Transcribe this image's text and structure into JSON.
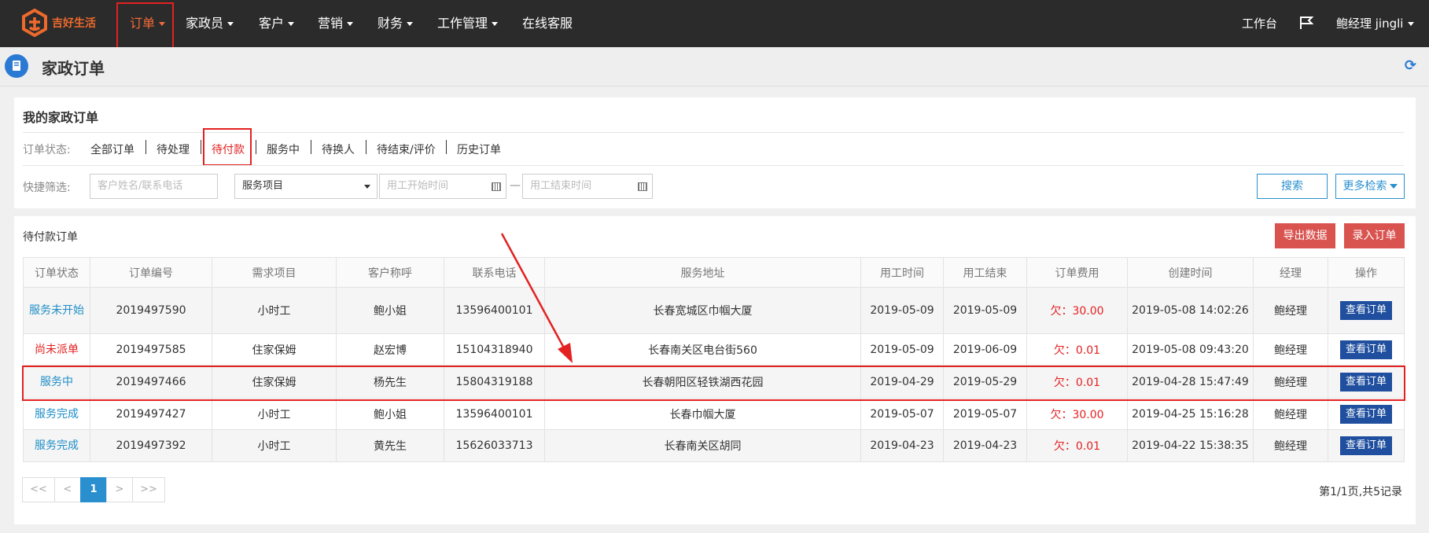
{
  "brand": {
    "name": "吉好生活",
    "color": "#ee6a2c"
  },
  "nav": {
    "items": [
      {
        "label": "订单",
        "dropdown": true,
        "active": true
      },
      {
        "label": "家政员",
        "dropdown": true
      },
      {
        "label": "客户",
        "dropdown": true
      },
      {
        "label": "营销",
        "dropdown": true
      },
      {
        "label": "财务",
        "dropdown": true
      },
      {
        "label": "工作管理",
        "dropdown": true
      },
      {
        "label": "在线客服",
        "dropdown": false
      }
    ],
    "workbench": "工作台",
    "flag_icon": "flag-icon",
    "user": "鲍经理 jingli"
  },
  "page": {
    "title": "家政订单",
    "icon": "book-icon",
    "refresh_icon": "refresh-icon"
  },
  "filters": {
    "title": "我的家政订单",
    "status_label": "订单状态:",
    "statuses": [
      "全部订单",
      "待处理",
      "待付款",
      "服务中",
      "待换人",
      "待结束/评价",
      "历史订单"
    ],
    "active_status": "待付款",
    "quick_label": "快捷筛选:",
    "customer_placeholder": "客户姓名/联系电话",
    "service_select": "服务项目",
    "start_placeholder": "用工开始时间",
    "range_sep": "—",
    "end_placeholder": "用工结束时间",
    "search_button": "搜索",
    "more_button": "更多检索"
  },
  "table_panel": {
    "title": "待付款订单",
    "export_button": "导出数据",
    "add_button": "录入订单",
    "columns": [
      "订单状态",
      "订单编号",
      "需求项目",
      "客户称呼",
      "联系电话",
      "服务地址",
      "用工时间",
      "用工结束",
      "订单费用",
      "创建时间",
      "经理",
      "操作"
    ],
    "rows": [
      {
        "status": "服务未开始",
        "status_color": "#1f8ec7",
        "id": "2019497590",
        "item": "小时工",
        "customer": "鲍小姐",
        "phone": "13596400101",
        "address": "长春宽城区巾帼大厦",
        "start": "2019-05-09",
        "end": "2019-05-09",
        "fee": "欠：30.00",
        "created": "2019-05-08 14:02:26",
        "manager": "鲍经理",
        "action": "查看订单"
      },
      {
        "status": "尚未派单",
        "status_color": "#e32121",
        "id": "2019497585",
        "item": "住家保姆",
        "customer": "赵宏博",
        "phone": "15104318940",
        "address": "长春南关区电台街560",
        "start": "2019-05-09",
        "end": "2019-06-09",
        "fee": "欠：0.01",
        "created": "2019-05-08 09:43:20",
        "manager": "鲍经理",
        "action": "查看订单"
      },
      {
        "status": "服务中",
        "status_color": "#1f8ec7",
        "id": "2019497466",
        "item": "住家保姆",
        "customer": "杨先生",
        "phone": "15804319188",
        "address": "长春朝阳区轻铁湖西花园",
        "start": "2019-04-29",
        "end": "2019-05-29",
        "fee": "欠：0.01",
        "created": "2019-04-28 15:47:49",
        "manager": "鲍经理",
        "action": "查看订单"
      },
      {
        "status": "服务完成",
        "status_color": "#1f8ec7",
        "id": "2019497427",
        "item": "小时工",
        "customer": "鲍小姐",
        "phone": "13596400101",
        "address": "长春巾帼大厦",
        "start": "2019-05-07",
        "end": "2019-05-07",
        "fee": "欠：30.00",
        "created": "2019-04-25 15:16:28",
        "manager": "鲍经理",
        "action": "查看订单"
      },
      {
        "status": "服务完成",
        "status_color": "#1f8ec7",
        "id": "2019497392",
        "item": "小时工",
        "customer": "黄先生",
        "phone": "15626033713",
        "address": "长春南关区胡同",
        "start": "2019-04-23",
        "end": "2019-04-23",
        "fee": "欠：0.01",
        "created": "2019-04-22 15:38:35",
        "manager": "鲍经理",
        "action": "查看订单"
      }
    ]
  },
  "pagination": {
    "first": "<<",
    "prev": "<",
    "current": "1",
    "next": ">",
    "last": ">>",
    "info": "第1/1页,共5记录"
  },
  "colors": {
    "accent_red": "#e32121",
    "link_blue": "#1f8ec7",
    "button_navy": "#1f4f9e",
    "nav_bg": "#2b2b2b"
  }
}
